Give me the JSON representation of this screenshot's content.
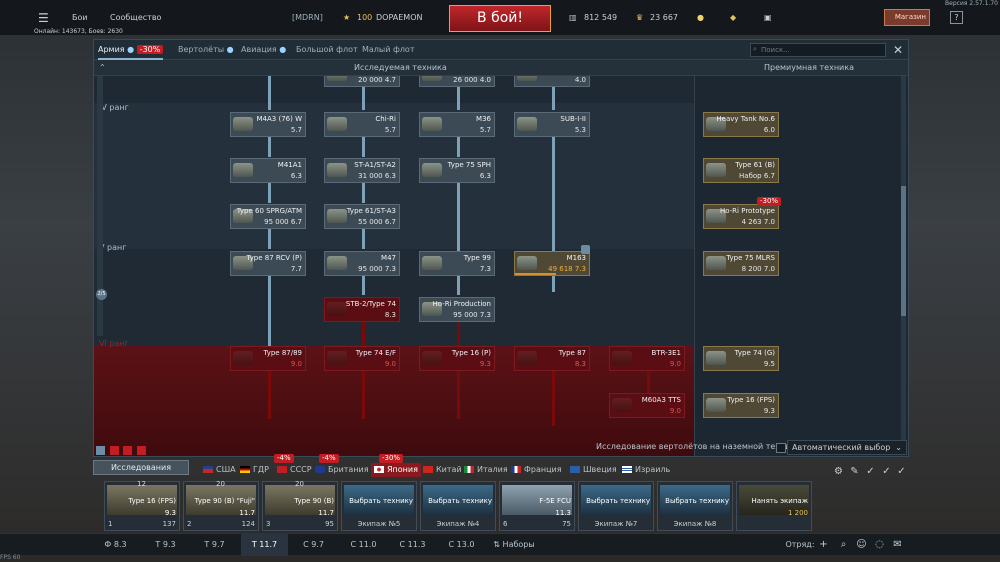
{
  "top_bar": {
    "menu_label": "Бои",
    "community_label": "Сообщество",
    "squadron": "[MDRN]",
    "player_level": "100",
    "player_name": "DOPAEMON",
    "battle_button": "В бой!",
    "silver_lions": "812 549",
    "research_points": "23 667",
    "shop_label": "Магазин",
    "help_label": "?",
    "version": "Версия 2.57.1.70",
    "online": "Онлайн: 143673, Боев: 2630"
  },
  "tabs": [
    {
      "label": "Армия",
      "discount": "-30%"
    },
    {
      "label": "Вертолёты"
    },
    {
      "label": "Авиация"
    },
    {
      "label": "Большой флот"
    },
    {
      "label": "Малый флот"
    }
  ],
  "search_placeholder": "Поиск...",
  "researched_header": "Исследуемая техника",
  "premium_header": "Премиумная техника",
  "ranks": [
    "IV ранг",
    "V ранг",
    "VI ранг"
  ],
  "tree_top": [
    {
      "sub": "20 000 4.7"
    },
    {
      "sub": "26 000 4.0"
    },
    {
      "sub": "4.0"
    }
  ],
  "tree": [
    {
      "name": "M4A3 (76) W",
      "sub": "5.7"
    },
    {
      "name": "Chi-Ri",
      "sub": "5.7"
    },
    {
      "name": "M36",
      "sub": "5.7"
    },
    {
      "name": "SUB-I-II",
      "sub": "5.3"
    },
    {
      "name": "M41A1",
      "sub": "6.3"
    },
    {
      "name": "ST-A1/ST-A2",
      "sub": "31 000 6.3"
    },
    {
      "name": "Type 75 SPH",
      "sub": "6.3"
    },
    {
      "name": "Type 60 SPRG/ATM",
      "sub": "95 000 6.7"
    },
    {
      "name": "Type 61/ST-A3",
      "sub": "55 000 6.7"
    },
    {
      "name": "Type 87 RCV (P)",
      "sub": "7.7"
    },
    {
      "name": "M47",
      "sub": "95 000 7.3"
    },
    {
      "name": "Type 99",
      "sub": "7.3"
    },
    {
      "name": "M163",
      "sub": "49 618 7.3"
    },
    {
      "name": "STB-2/Type 74",
      "sub": "8.3"
    },
    {
      "name": "Ho-Ri Production",
      "sub": "95 000 7.3"
    },
    {
      "name": "Type 87/89",
      "sub": "9.0"
    },
    {
      "name": "Type 74 E/F",
      "sub": "9.0"
    },
    {
      "name": "Type 16 (P)",
      "sub": "9.3"
    },
    {
      "name": "Type 87",
      "sub": "8.3"
    },
    {
      "name": "BTR-3E1",
      "sub": "9.0"
    },
    {
      "name": "M60A3 TTS",
      "sub": "9.0"
    }
  ],
  "premium": [
    {
      "name": "Heavy Tank No.6",
      "sub": "6.0"
    },
    {
      "name": "Type 61 (B)",
      "sub": "Набор 6.7"
    },
    {
      "name": "Ho-Ri Prototype",
      "sub": "4 263 7.0",
      "discount": "-30%"
    },
    {
      "name": "Type 75 MLRS",
      "sub": "8 200 7.0"
    },
    {
      "name": "Type 74 (G)",
      "sub": "9.5"
    },
    {
      "name": "Type 16 (FPS)",
      "sub": "9.3"
    }
  ],
  "heli_research_text": "Исследование вертолётов на наземной технике",
  "auto_select": "Автоматический выбор",
  "research_tab": "Исследования",
  "nations": [
    {
      "label": "США"
    },
    {
      "label": "ГДР",
      "discount": "-4%"
    },
    {
      "label": "СССР",
      "discount": "-4%"
    },
    {
      "label": "Британия"
    },
    {
      "label": "Япония",
      "discount": "-30%"
    },
    {
      "label": "Китай"
    },
    {
      "label": "Италия"
    },
    {
      "label": "Франция"
    },
    {
      "label": "Швеция"
    },
    {
      "label": "Израиль"
    }
  ],
  "crew_slots": [
    {
      "name": "Type 16 (FPS)",
      "br": "9.3",
      "crew": "1",
      "pts": "137",
      "count": "12"
    },
    {
      "name": "Type 90 (B) \"Fuji\"",
      "br": "11.7",
      "crew": "2",
      "pts": "124",
      "count": "20"
    },
    {
      "name": "Type 90 (B)",
      "br": "11.7",
      "crew": "3",
      "pts": "95",
      "count": "20"
    },
    {
      "name": "Выбрать технику",
      "label": "Экипаж №5"
    },
    {
      "name": "Выбрать технику",
      "label": "Экипаж №4"
    },
    {
      "name": "F-5E FCU",
      "br": "11.3",
      "crew": "6",
      "pts": "75"
    },
    {
      "name": "Выбрать технику",
      "label": "Экипаж №7"
    },
    {
      "name": "Выбрать технику",
      "label": "Экипаж №8"
    },
    {
      "name": "Нанять экипаж",
      "sub": "1 200"
    }
  ],
  "br_tabs": [
    "Ф 8.3",
    "Т 9.3",
    "Т 9.7",
    "Т 11.7",
    "С 9.7",
    "С 11.0",
    "С 11.3",
    "С 13.0"
  ],
  "presets_label": "Наборы",
  "squad_label": "Отряд:",
  "fps": "FPS 60",
  "colors": {
    "accent_red": "#c11d22",
    "research_bar": "#d2912a",
    "premium_gold": "#8a7a4a"
  }
}
